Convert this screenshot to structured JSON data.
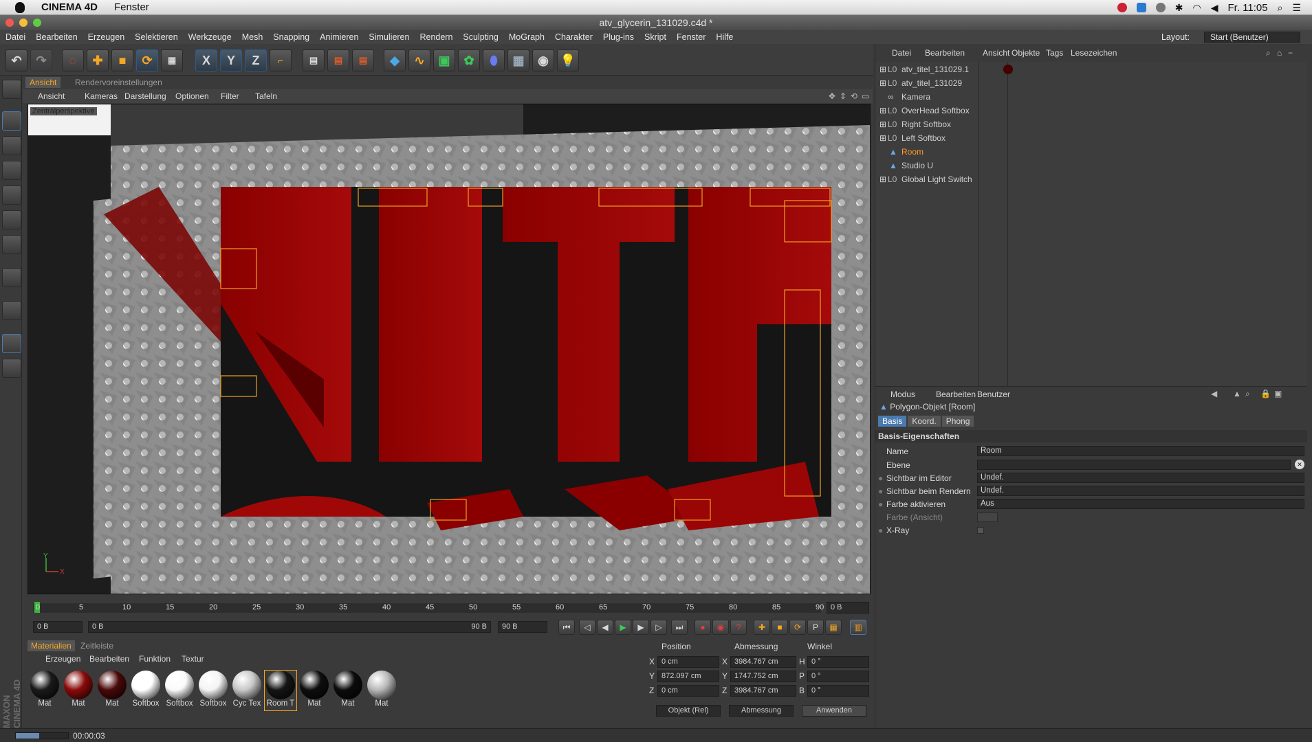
{
  "mac": {
    "app": "CINEMA 4D",
    "menu": "Fenster",
    "clock": "Fr. 11:05"
  },
  "window": {
    "title": "atv_glycerin_131029.c4d *"
  },
  "menu": [
    "Datei",
    "Bearbeiten",
    "Erzeugen",
    "Selektieren",
    "Werkzeuge",
    "Mesh",
    "Snapping",
    "Animieren",
    "Simulieren",
    "Rendern",
    "Sculpting",
    "MoGraph",
    "Charakter",
    "Plug-ins",
    "Skript",
    "Fenster",
    "Hilfe"
  ],
  "layout": {
    "label": "Layout:",
    "value": "Start (Benutzer)"
  },
  "toolbar": {
    "x": "X",
    "y": "Y",
    "z": "Z"
  },
  "viewport": {
    "tabs": [
      "Ansicht",
      "Rendervoreinstellungen"
    ],
    "menu": [
      "Ansicht",
      "Kameras",
      "Darstellung",
      "Optionen",
      "Filter",
      "Tafeln"
    ],
    "camera_label": "Zentralperspektive",
    "axis_y": "Y",
    "axis_x": "X"
  },
  "timeline": {
    "ticks": [
      "0",
      "5",
      "10",
      "15",
      "20",
      "25",
      "30",
      "35",
      "40",
      "45",
      "50",
      "55",
      "60",
      "65",
      "70",
      "75",
      "80",
      "85",
      "90"
    ],
    "frame": "0 B"
  },
  "playbar": {
    "start": "0 B",
    "range_left": "0 B",
    "range_right": "90 B",
    "end": "90 B"
  },
  "materials": {
    "tabs": [
      "Materialien",
      "Zeitleiste"
    ],
    "menu": [
      "Erzeugen",
      "Bearbeiten",
      "Funktion",
      "Textur"
    ],
    "items": [
      {
        "label": "Mat",
        "color": "#1a1a1a"
      },
      {
        "label": "Mat",
        "color": "#8a0a0a"
      },
      {
        "label": "Mat",
        "color": "#4a0808"
      },
      {
        "label": "Softbox",
        "color": "#ffffff"
      },
      {
        "label": "Softbox",
        "color": "#fafafa"
      },
      {
        "label": "Softbox",
        "color": "#f4f4f4"
      },
      {
        "label": "Cyc Tex",
        "color": "#c8c8c8"
      },
      {
        "label": "Room T",
        "color": "#151515"
      },
      {
        "label": "Mat",
        "color": "#0e0e0e"
      },
      {
        "label": "Mat",
        "color": "#0c0c0c"
      },
      {
        "label": "Mat",
        "color": "#b8b8b8"
      }
    ]
  },
  "coords": {
    "headers": [
      "Position",
      "Abmessung",
      "Winkel"
    ],
    "rows": [
      {
        "axis": "X",
        "pos": "0 cm",
        "dim_axis": "X",
        "dim": "3984.767 cm",
        "ang_axis": "H",
        "ang": "0 °"
      },
      {
        "axis": "Y",
        "pos": "872.097 cm",
        "dim_axis": "Y",
        "dim": "1747.752 cm",
        "ang_axis": "P",
        "ang": "0 °"
      },
      {
        "axis": "Z",
        "pos": "0 cm",
        "dim_axis": "Z",
        "dim": "3984.767 cm",
        "ang_axis": "B",
        "ang": "0 °"
      }
    ],
    "mode": "Objekt (Rel)",
    "size_mode": "Abmessung",
    "apply": "Anwenden"
  },
  "objects": {
    "menu": [
      "Datei",
      "Bearbeiten",
      "Ansicht",
      "Objekte",
      "Tags",
      "Lesezeichen"
    ],
    "rows": [
      {
        "name": "atv_titel_131029.1",
        "color": "#cfcfcf"
      },
      {
        "name": "atv_titel_131029",
        "color": "#cfcfcf"
      },
      {
        "name": "Kamera",
        "color": "#cfcfcf"
      },
      {
        "name": "OverHead Softbox",
        "color": "#cfcfcf"
      },
      {
        "name": "Right Softbox",
        "color": "#cfcfcf"
      },
      {
        "name": "Left Softbox",
        "color": "#cfcfcf"
      },
      {
        "name": "Room",
        "color": "#ff9a2a"
      },
      {
        "name": "Studio U",
        "color": "#cfcfcf"
      },
      {
        "name": "Global Light Switch",
        "color": "#cfcfcf"
      }
    ]
  },
  "attributes": {
    "menu": [
      "Modus",
      "Bearbeiten",
      "Benutzer"
    ],
    "object_title": "Polygon-Objekt [Room]",
    "tabs": [
      "Basis",
      "Koord.",
      "Phong"
    ],
    "section": "Basis-Eigenschaften",
    "name_label": "Name",
    "name_value": "Room",
    "layer_label": "Ebene",
    "vis_editor_label": "Sichtbar im Editor",
    "vis_editor_value": "Undef.",
    "vis_render_label": "Sichtbar beim Rendern",
    "vis_render_value": "Undef.",
    "color_enable_label": "Farbe aktivieren",
    "color_enable_value": "Aus",
    "color_view_label": "Farbe (Ansicht)",
    "xray_label": "X-Ray"
  },
  "status": {
    "time": "00:00:03"
  },
  "brand": "MAXON CINEMA 4D"
}
